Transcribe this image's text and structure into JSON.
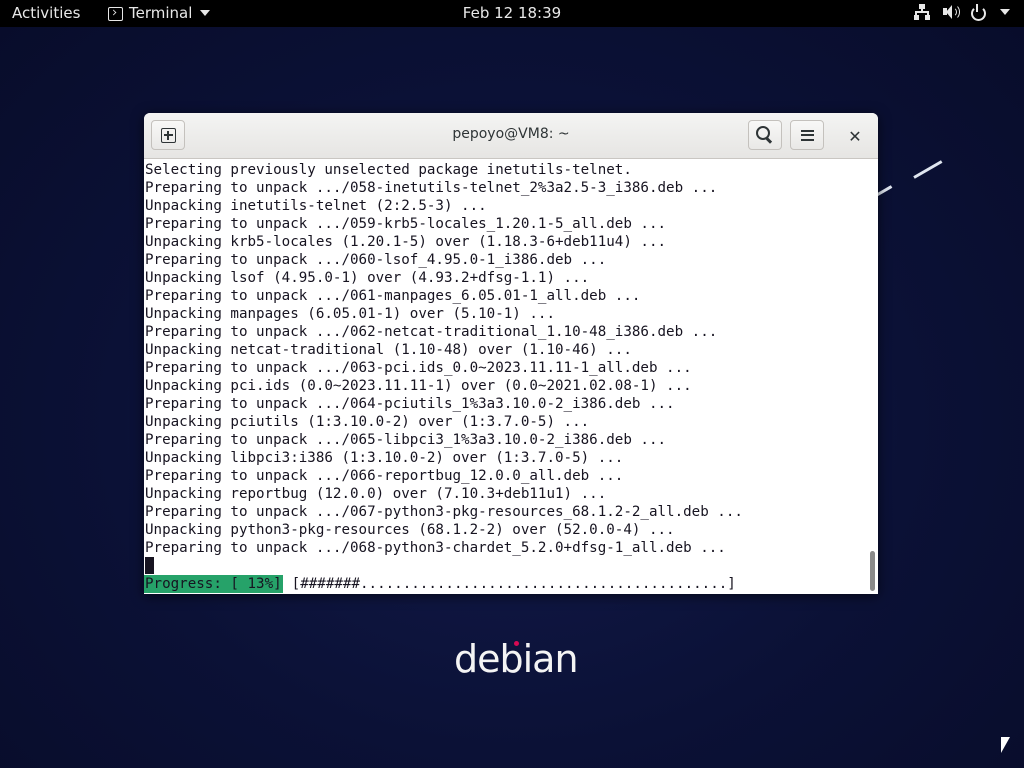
{
  "topbar": {
    "activities": "Activities",
    "app_name": "Terminal",
    "clock": "Feb 12  18:39",
    "tray": {
      "network_icon": "network-wired-icon",
      "volume_icon": "speaker-volume-icon",
      "power_icon": "power-icon"
    }
  },
  "window": {
    "title": "pepoyo@VM8: ~",
    "buttons": {
      "new_tab_icon": "new-tab-icon",
      "search_icon": "search-icon",
      "menu_icon": "hamburger-menu-icon",
      "close_icon": "close-icon",
      "close_glyph": "✕"
    }
  },
  "terminal": {
    "lines": [
      "Selecting previously unselected package inetutils-telnet.",
      "Preparing to unpack .../058-inetutils-telnet_2%3a2.5-3_i386.deb ...",
      "Unpacking inetutils-telnet (2:2.5-3) ...",
      "Preparing to unpack .../059-krb5-locales_1.20.1-5_all.deb ...",
      "Unpacking krb5-locales (1.20.1-5) over (1.18.3-6+deb11u4) ...",
      "Preparing to unpack .../060-lsof_4.95.0-1_i386.deb ...",
      "Unpacking lsof (4.95.0-1) over (4.93.2+dfsg-1.1) ...",
      "Preparing to unpack .../061-manpages_6.05.01-1_all.deb ...",
      "Unpacking manpages (6.05.01-1) over (5.10-1) ...",
      "Preparing to unpack .../062-netcat-traditional_1.10-48_i386.deb ...",
      "Unpacking netcat-traditional (1.10-48) over (1.10-46) ...",
      "Preparing to unpack .../063-pci.ids_0.0~2023.11.11-1_all.deb ...",
      "Unpacking pci.ids (0.0~2023.11.11-1) over (0.0~2021.02.08-1) ...",
      "Preparing to unpack .../064-pciutils_1%3a3.10.0-2_i386.deb ...",
      "Unpacking pciutils (1:3.10.0-2) over (1:3.7.0-5) ...",
      "Preparing to unpack .../065-libpci3_1%3a3.10.0-2_i386.deb ...",
      "Unpacking libpci3:i386 (1:3.10.0-2) over (1:3.7.0-5) ...",
      "Preparing to unpack .../066-reportbug_12.0.0_all.deb ...",
      "Unpacking reportbug (12.0.0) over (7.10.3+deb11u1) ...",
      "Preparing to unpack .../067-python3-pkg-resources_68.1.2-2_all.deb ...",
      "Unpacking python3-pkg-resources (68.1.2-2) over (52.0.0-4) ...",
      "Preparing to unpack .../068-python3-chardet_5.2.0+dfsg-1_all.deb ..."
    ],
    "progress_label": "Progress: [ 13%]",
    "progress_bar": "[#######...........................................]",
    "progress_percent": 13
  },
  "desktop": {
    "logo_text": "debian"
  },
  "colors": {
    "progress_bg": "#26a269",
    "desktop_bg": "#0b1136",
    "debian_dot": "#d70a53"
  }
}
